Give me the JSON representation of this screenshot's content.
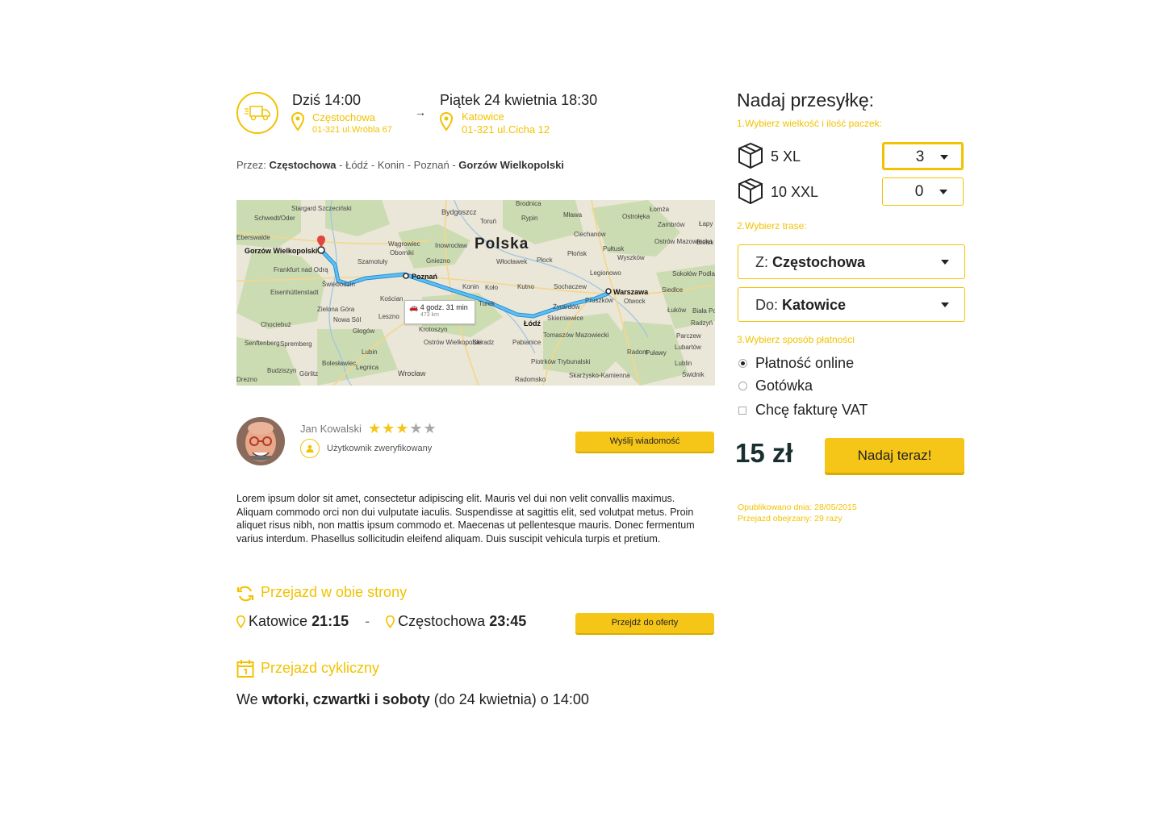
{
  "route": {
    "from": {
      "date": "Dziś 14:00",
      "city": "Częstochowa",
      "address": "01-321 ul.Wróbla 67"
    },
    "to": {
      "date": "Piątek 24 kwietnia 18:30",
      "city": "Katowice",
      "address": "01-321 ul.Cicha 12"
    },
    "arrow": "→",
    "via_label": "Przez:",
    "via_start": "Częstochowa",
    "via_middle": " - Łódź - Konin - Poznań - ",
    "via_end": "Gorzów Wielkopolski"
  },
  "map": {
    "country": "Polska",
    "route_time": "4 godz. 31 min",
    "route_distance": "473 km",
    "labels": {
      "gorzow": "Gorzów Wielkopolski",
      "poznan": "Poznań",
      "warszawa": "Warszawa",
      "lodz": "Łódź",
      "bydgoszcz": "Bydgoszcz",
      "torun": "Toruń",
      "plock": "Płock",
      "konin": "Konin",
      "kalisz": "Kalisz",
      "wroclaw": "Wrocław",
      "radom": "Radom",
      "lublin": "Lublin",
      "piotrkow": "Piotrków Trybunalski",
      "szczecinek": "Stargard Szczeciński",
      "zielona": "Zielona Góra",
      "leszno": "Leszno",
      "glogow": "Głogów",
      "legnica": "Legnica",
      "ostrow": "Ostrów Wielkopolski",
      "siedlce": "Siedlce",
      "gniezno": "Gniezno",
      "wloclawek": "Włocławek",
      "frankfurt": "Frankfurt nad Odrą",
      "drezno": "Drezno",
      "lomza": "Łomża",
      "ostroleka": "Ostrołęka",
      "ciechanow": "Ciechanów",
      "pulawy": "Puławy",
      "skarzysko": "Skarżysko-Kamienna",
      "tomaszow": "Tomaszów Mazowiecki",
      "pruszkow": "Pruszków",
      "zyrardow": "Żyrardów",
      "kutno": "Kutno",
      "sochaczew": "Sochaczew",
      "legionowo": "Legionowo",
      "otwock": "Otwock",
      "skierniewice": "Skierniewice",
      "pabianice": "Pabianice",
      "sieradz": "Sieradz",
      "turek": "Turek",
      "krotoszyn": "Krotoszyn",
      "lubin": "Lubin",
      "boleslawiec": "Bolesławiec",
      "gorlitz": "Görlitz",
      "budziszyn": "Budziszyn",
      "swiebodzin": "Świebodzin",
      "koscian": "Kościan",
      "radomsko": "Radomsko",
      "lukow": "Łuków",
      "biala": "Biała Podlaska",
      "mlawa": "Mława",
      "plonsk": "Płońsk",
      "pultusk": "Pułtusk",
      "wyszkow": "Wyszków",
      "rypin": "Rypin",
      "wagrowiec": "Wągrowiec",
      "oborniki": "Oborniki",
      "szamotuly": "Szamotuły",
      "inowroclaw": "Inowrocław",
      "sokolow": "Sokołów Podlaski",
      "eisenhuttenstadt": "Eisenhüttenstadt",
      "chociebuz": "Chociebuż",
      "senftenberg": "Senftenberg",
      "spremberg": "Spremberg",
      "nowasol": "Nowa Sól",
      "brodnica": "Brodnica",
      "lubartow": "Lubartów",
      "radzyn": "Radzyń Podlaski",
      "parczew": "Parczew",
      "swidnik": "Świdnik",
      "bielsk": "Bielsk",
      "lapy": "Łapy",
      "zambrow": "Zambrów",
      "ostrowmaz": "Ostrów Mazowiecka",
      "kolo": "Koło",
      "schwedt": "Schwedt/Oder",
      "berswalde": "Eberswalde"
    }
  },
  "user": {
    "name": "Jan Kowalski",
    "stars_filled": "★★★",
    "stars_empty": "★★",
    "rating": 3,
    "rating_max": 5,
    "verified": "Użytkownik zweryfikowany",
    "message_button": "Wyślij wiadomość"
  },
  "description": "Lorem ipsum dolor sit amet, consectetur adipiscing elit. Mauris vel dui non velit convallis maximus. Aliquam commodo orci non dui vulputate iaculis. Suspendisse at sagittis elit, sed volutpat metus. Proin aliquet risus nibh, non mattis ipsum commodo et. Maecenas ut pellentesque mauris. Donec fermentum varius interdum. Phasellus sollicitudin eleifend aliquam. Duis suscipit vehicula turpis et pretium.",
  "return_trip": {
    "title": "Przejazd w obie strony",
    "from_city": "Katowice",
    "from_time": "21:15",
    "separator": "-",
    "to_city": "Częstochowa",
    "to_time": "23:45",
    "button": "Przejdź do oferty"
  },
  "cyclic": {
    "title": "Przejazd cykliczny",
    "prefix": "We ",
    "days": "wtorki, czwartki i soboty",
    "suffix": " (do 24 kwietnia) o 14:00"
  },
  "panel": {
    "title": "Nadaj przesyłkę:",
    "step1": "1.Wybierz wielkość i ilość paczek:",
    "packages": [
      {
        "label": "5 XL",
        "qty": "3"
      },
      {
        "label": "10 XXL",
        "qty": "0"
      }
    ],
    "step2": "2.Wybierz trase:",
    "from_prefix": "Z: ",
    "from_value": "Częstochowa",
    "to_prefix": "Do: ",
    "to_value": "Katowice",
    "step3": "3.Wybierz sposób płatności",
    "pay_online": "Płatność online",
    "pay_cash": "Gotówka",
    "invoice": "Chcę fakturę VAT",
    "price": "15 zł",
    "send_button": "Nadaj teraz!",
    "published": "Opublikowano dnia: 28/05/2015",
    "views": "Przejazd obejrzany: 29 razy"
  },
  "colors": {
    "accent": "#f2c200",
    "button": "#f5c518",
    "route": "#3aa7e0"
  }
}
